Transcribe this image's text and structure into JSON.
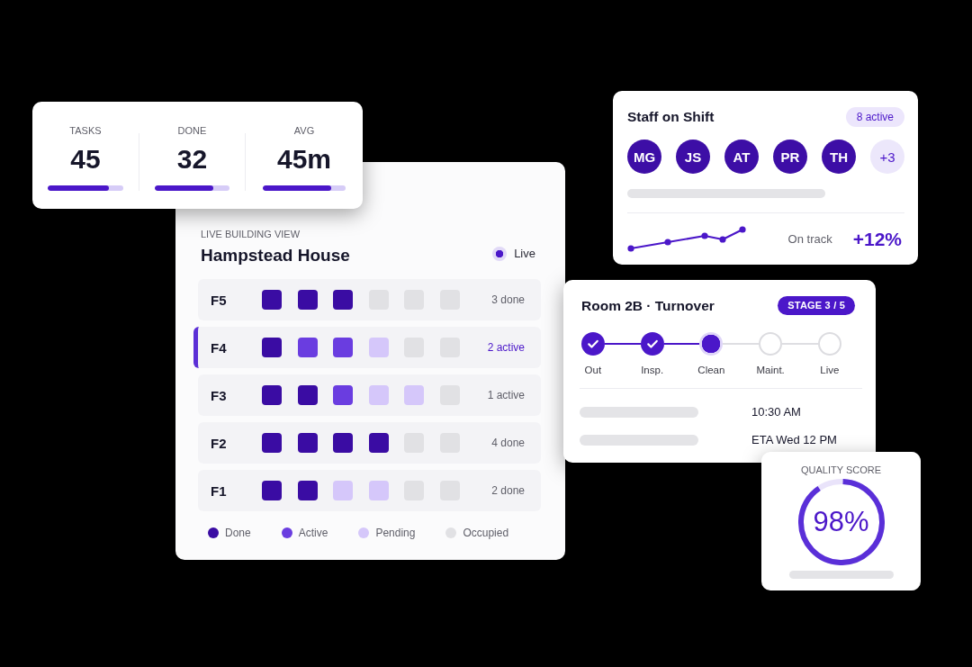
{
  "stats": [
    {
      "label": "TASKS",
      "value": "45",
      "level": 0.81
    },
    {
      "label": "DONE",
      "value": "32",
      "level": 0.78
    },
    {
      "label": "AVG",
      "value": "45m",
      "level": 0.82
    }
  ],
  "building": {
    "section_label": "LIVE BUILDING VIEW",
    "title": "Hampstead House",
    "live_label": "Live",
    "floors": [
      {
        "label": "F5",
        "selected": false,
        "note": "3 done",
        "units": [
          {
            "kind": "done"
          },
          {
            "kind": "done"
          },
          {
            "kind": "done"
          },
          {
            "kind": "occupied"
          },
          {
            "kind": "occupied"
          },
          {
            "kind": "occupied"
          }
        ]
      },
      {
        "label": "F4",
        "selected": true,
        "note": "2 active",
        "units": [
          {
            "kind": "done"
          },
          {
            "kind": "active"
          },
          {
            "kind": "active"
          },
          {
            "kind": "pending"
          },
          {
            "kind": "occupied"
          },
          {
            "kind": "occupied"
          }
        ]
      },
      {
        "label": "F3",
        "selected": false,
        "note": "1 active",
        "units": [
          {
            "kind": "done"
          },
          {
            "kind": "done"
          },
          {
            "kind": "active"
          },
          {
            "kind": "pending"
          },
          {
            "kind": "pending"
          },
          {
            "kind": "occupied"
          }
        ]
      },
      {
        "label": "F2",
        "selected": false,
        "note": "4 done",
        "units": [
          {
            "kind": "done"
          },
          {
            "kind": "done"
          },
          {
            "kind": "done"
          },
          {
            "kind": "done"
          },
          {
            "kind": "occupied"
          },
          {
            "kind": "occupied"
          }
        ]
      },
      {
        "label": "F1",
        "selected": false,
        "note": "2 done",
        "units": [
          {
            "kind": "done"
          },
          {
            "kind": "done"
          },
          {
            "kind": "pending"
          },
          {
            "kind": "pending"
          },
          {
            "kind": "occupied"
          },
          {
            "kind": "occupied"
          }
        ]
      }
    ],
    "legend": [
      {
        "label": "Done",
        "color": "#3a0ca3"
      },
      {
        "label": "Active",
        "color": "#6a3de0"
      },
      {
        "label": "Pending",
        "color": "#d5c7fa"
      },
      {
        "label": "Occupied",
        "color": "#e1e1e4"
      }
    ]
  },
  "staff": {
    "title": "Staff on Shift",
    "badge": "8 active",
    "avatars": [
      "MG",
      "JS",
      "AT",
      "PR",
      "TH"
    ],
    "overflow": "+3",
    "status": "On track",
    "trend": "+12%"
  },
  "room": {
    "title": "Room 2B · Turnover",
    "badge": "STAGE 3 / 5",
    "steps": [
      {
        "label": "Out",
        "kind": "done"
      },
      {
        "label": "Insp.",
        "kind": "done"
      },
      {
        "label": "Clean",
        "kind": "current"
      },
      {
        "label": "Maint.",
        "kind": "pending"
      },
      {
        "label": "Live",
        "kind": "pending"
      }
    ],
    "times": [
      "10:30 AM",
      "ETA Wed 12 PM"
    ]
  },
  "quality": {
    "label": "QUALITY SCORE",
    "value": "98%",
    "level": 0.9
  }
}
